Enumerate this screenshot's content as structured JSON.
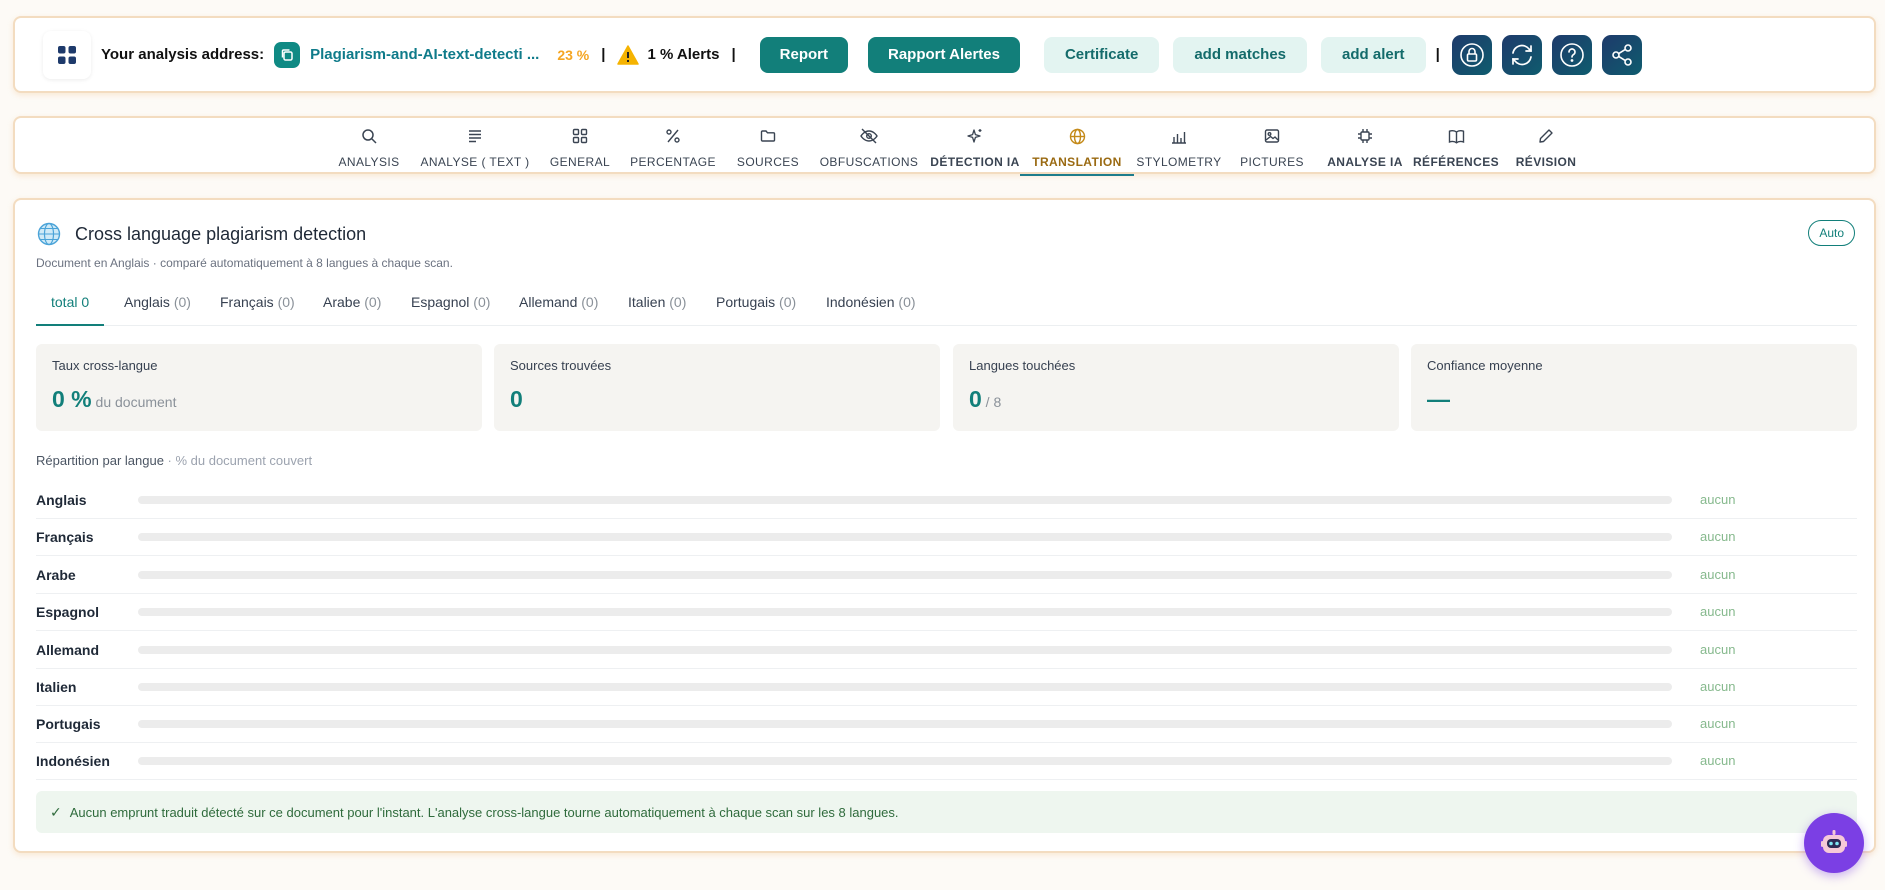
{
  "topbar": {
    "address_label": "Your analysis address:",
    "file_name": "Plagiarism-and-AI-text-detecti ...",
    "percent": "23 %",
    "separator": "|",
    "alerts": "1 % Alerts",
    "buttons": {
      "report": "Report",
      "rapport_alertes": "Rapport Alertes",
      "certificate": "Certificate",
      "add_matches": "add matches",
      "add_alert": "add alert"
    },
    "icons": [
      "apps-icon",
      "copy-icon",
      "warning-icon",
      "lock-icon",
      "refresh-icon",
      "help-icon",
      "share-icon"
    ]
  },
  "tabs": [
    {
      "label": "ANALYSIS",
      "icon": "search-icon"
    },
    {
      "label": "ANALYSE ( TEXT )",
      "icon": "text-lines-icon"
    },
    {
      "label": "GENERAL",
      "icon": "grid-icon"
    },
    {
      "label": "PERCENTAGE",
      "icon": "percent-icon"
    },
    {
      "label": "SOURCES",
      "icon": "folder-icon"
    },
    {
      "label": "OBFUSCATIONS",
      "icon": "eye-off-icon"
    },
    {
      "label": "DÉTECTION IA",
      "icon": "sparkles-icon"
    },
    {
      "label": "TRANSLATION",
      "icon": "globe-icon",
      "active": true
    },
    {
      "label": "STYLOMETRY",
      "icon": "bar-chart-icon"
    },
    {
      "label": "PICTURES",
      "icon": "image-icon"
    },
    {
      "label": "ANALYSE IA",
      "icon": "chip-icon"
    },
    {
      "label": "RÉFÉRENCES",
      "icon": "book-icon"
    },
    {
      "label": "RÉVISION",
      "icon": "pencil-icon"
    }
  ],
  "panel": {
    "title": "Cross language plagiarism detection",
    "subtitle": "Document en Anglais · comparé automatiquement à 8 langues à chaque scan.",
    "auto_label": "Auto",
    "lang_tabs": [
      {
        "label": "total",
        "count": "0"
      },
      {
        "label": "Anglais",
        "count": "(0)"
      },
      {
        "label": "Français",
        "count": "(0)"
      },
      {
        "label": "Arabe",
        "count": "(0)"
      },
      {
        "label": "Espagnol",
        "count": "(0)"
      },
      {
        "label": "Allemand",
        "count": "(0)"
      },
      {
        "label": "Italien",
        "count": "(0)"
      },
      {
        "label": "Portugais",
        "count": "(0)"
      },
      {
        "label": "Indonésien",
        "count": "(0)"
      }
    ],
    "cards": [
      {
        "label": "Taux cross-langue",
        "value": "0 %",
        "suffix": " du document"
      },
      {
        "label": "Sources trouvées",
        "value": "0",
        "suffix": ""
      },
      {
        "label": "Langues touchées",
        "value": "0",
        "suffix": " / 8"
      },
      {
        "label": "Confiance moyenne",
        "value": "—",
        "suffix": ""
      }
    ],
    "breakdown_title": "Répartition par langue",
    "breakdown_hint": " · % du document couvert",
    "languages": [
      {
        "name": "Anglais",
        "coverage": 0,
        "value_text": "aucun"
      },
      {
        "name": "Français",
        "coverage": 0,
        "value_text": "aucun"
      },
      {
        "name": "Arabe",
        "coverage": 0,
        "value_text": "aucun"
      },
      {
        "name": "Espagnol",
        "coverage": 0,
        "value_text": "aucun"
      },
      {
        "name": "Allemand",
        "coverage": 0,
        "value_text": "aucun"
      },
      {
        "name": "Italien",
        "coverage": 0,
        "value_text": "aucun"
      },
      {
        "name": "Portugais",
        "coverage": 0,
        "value_text": "aucun"
      },
      {
        "name": "Indonésien",
        "coverage": 0,
        "value_text": "aucun"
      }
    ],
    "notice": "Aucun emprunt traduit détecté sur ce document pour l'instant. L'analyse cross-langue tourne automatiquement à chaque scan sur les 8 langues.",
    "notice_icon": "✓"
  },
  "colors": {
    "accent": "#127f7a",
    "active_tab": "#9a6a12",
    "frame_border": "#f3dcc0",
    "warning": "#f5a623",
    "bot": "#7b3fe4"
  }
}
